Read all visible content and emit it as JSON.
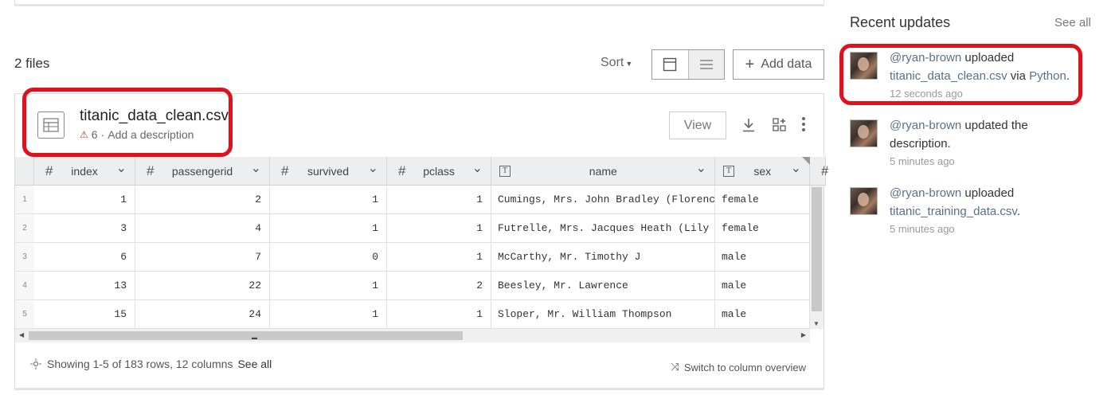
{
  "files_count": "2 files",
  "toolbar": {
    "sort_label": "Sort",
    "add_data_label": "Add data"
  },
  "file": {
    "name": "titanic_data_clean.csv",
    "warning_count": "6",
    "meta_sep": " · ",
    "description_placeholder": "Add a description",
    "view_label": "View"
  },
  "table": {
    "columns": [
      {
        "name": "index",
        "type": "number"
      },
      {
        "name": "passengerid",
        "type": "number"
      },
      {
        "name": "survived",
        "type": "number"
      },
      {
        "name": "pclass",
        "type": "number"
      },
      {
        "name": "name",
        "type": "text"
      },
      {
        "name": "sex",
        "type": "text"
      },
      {
        "name": "",
        "type": "number"
      }
    ],
    "row_numbers": [
      "1",
      "2",
      "3",
      "4",
      "5"
    ],
    "rows": [
      [
        "1",
        "2",
        "1",
        "1",
        "Cumings, Mrs. John Bradley (Florence B",
        "female"
      ],
      [
        "3",
        "4",
        "1",
        "1",
        "Futrelle, Mrs. Jacques Heath (Lily May",
        "female"
      ],
      [
        "6",
        "7",
        "0",
        "1",
        "McCarthy, Mr. Timothy J",
        "male"
      ],
      [
        "13",
        "22",
        "1",
        "2",
        "Beesley, Mr. Lawrence",
        "male"
      ],
      [
        "15",
        "24",
        "1",
        "1",
        "Sloper, Mr. William Thompson",
        "male"
      ]
    ]
  },
  "footer": {
    "showing": "Showing 1-5 of 183 rows, 12 columns",
    "see_all": "See all",
    "switch": "Switch to column overview"
  },
  "recent": {
    "title": "Recent updates",
    "see_all": "See all",
    "items": [
      {
        "user": "@ryan-brown",
        "action": " uploaded ",
        "target": "titanic_data_clean.csv",
        "mid": " via ",
        "via": "Python",
        "end": ".",
        "time": "12 seconds ago"
      },
      {
        "user": "@ryan-brown",
        "action": " updated the description.",
        "time": "5 minutes ago"
      },
      {
        "user": "@ryan-brown",
        "action": " uploaded ",
        "target": "titanic_training_data.csv",
        "end": ".",
        "time": "5 minutes ago"
      }
    ]
  },
  "colors": {
    "annotation": "#e0101c",
    "link": "#5a7089",
    "header_bg": "#eceef0"
  }
}
